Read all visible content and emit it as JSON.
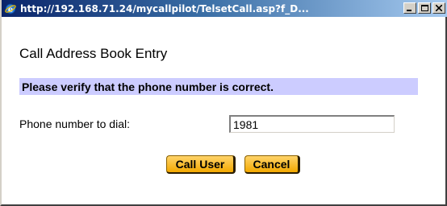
{
  "window": {
    "title": "http://192.168.71.24/mycallpilot/TelsetCall.asp?f_D...",
    "icon": "ie-icon",
    "controls": [
      "minimize-icon",
      "maximize-icon",
      "close-icon"
    ]
  },
  "dialog": {
    "heading": "Call Address Book Entry",
    "verify_message": "Please verify that the phone number is correct.",
    "phone_label": "Phone number to dial:",
    "phone_value": "1981",
    "call_button": "Call User",
    "cancel_button": "Cancel"
  },
  "colors": {
    "titlebar_start": "#0a246a",
    "titlebar_end": "#a6caf0",
    "verify_bar": "#ccccff",
    "button_fill": "#f3a900"
  }
}
